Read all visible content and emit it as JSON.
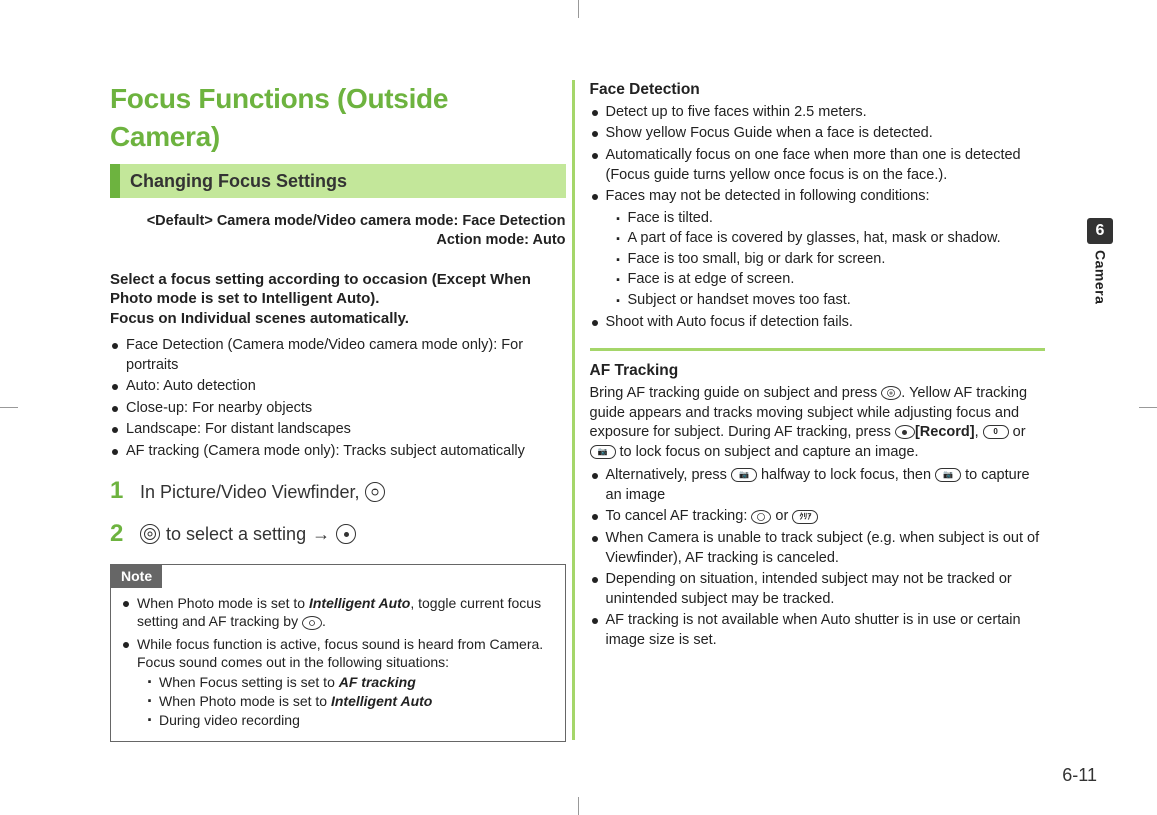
{
  "left": {
    "title": "Focus Functions (Outside Camera)",
    "section": "Changing Focus Settings",
    "default_label": "<Default>",
    "default_line1": "<Default> Camera mode/Video camera mode: Face Detection",
    "default_line2": "Action mode: Auto",
    "lead1": "Select a focus setting according to occasion (Except When Photo mode is set to Intelligent Auto).",
    "lead2": "Focus on Individual scenes automatically.",
    "modes": [
      "Face Detection (Camera mode/Video camera mode only): For portraits",
      "Auto: Auto detection",
      "Close-up: For nearby objects",
      "Landscape: For distant landscapes",
      "AF tracking (Camera mode only): Tracks subject automatically"
    ],
    "step1_num": "1",
    "step1_text": "In Picture/Video Viewfinder,",
    "step2_num": "2",
    "step2_text_a": "to select a setting",
    "step2_arrow": "→",
    "note_label": "Note",
    "note_items": {
      "n1_a": "When Photo mode is set to ",
      "n1_b": "Intelligent Auto",
      "n1_c": ", toggle current focus setting and AF tracking by ",
      "n1_d": ".",
      "n2": "While focus function is active, focus sound is heard from Camera. Focus sound comes out in the following situations:",
      "n2_sub": {
        "a_pre": "When Focus setting is set to ",
        "a_em": "AF tracking",
        "b_pre": "When Photo mode is set to ",
        "b_em": "Intelligent Auto",
        "c": "During video recording"
      }
    }
  },
  "right": {
    "face_head": "Face Detection",
    "face_items": {
      "f1": "Detect up to five faces within 2.5 meters.",
      "f2": "Show yellow Focus Guide when a face is detected.",
      "f3": "Automatically focus on one face when more than one is detected (Focus guide turns yellow once focus is on the face.).",
      "f4": "Faces may not be detected in following conditions:",
      "f4_sub": [
        "Face is tilted.",
        "A part of face is covered by glasses, hat, mask or shadow.",
        "Face is too small, big or dark for screen.",
        "Face is at edge of screen.",
        "Subject or handset moves too fast."
      ],
      "f5": "Shoot with Auto focus if detection fails."
    },
    "af_head": "AF Tracking",
    "af_para_a": "Bring AF tracking guide on subject and press ",
    "af_para_b": ". Yellow AF tracking guide appears and tracks moving subject while adjusting focus and exposure for subject. During AF tracking, press ",
    "af_record": "[Record]",
    "af_para_c": ", ",
    "af_para_d": " or ",
    "af_para_e": " to lock focus on subject and capture an image.",
    "af_items": {
      "a1_a": "Alternatively, press ",
      "a1_b": " halfway to lock focus, then ",
      "a1_c": " to capture an image",
      "a2_a": "To cancel AF tracking: ",
      "a2_b": " or ",
      "a3": "When Camera is unable to track subject (e.g. when subject is out of Viewfinder), AF tracking is canceled.",
      "a4": "Depending on situation, intended subject may not be tracked or unintended subject may be tracked.",
      "a5": "AF tracking is not available when Auto shutter is in use or certain image size is set."
    }
  },
  "side": {
    "chapter_num": "6",
    "chapter_label": "Camera"
  },
  "page_number": "6-11"
}
